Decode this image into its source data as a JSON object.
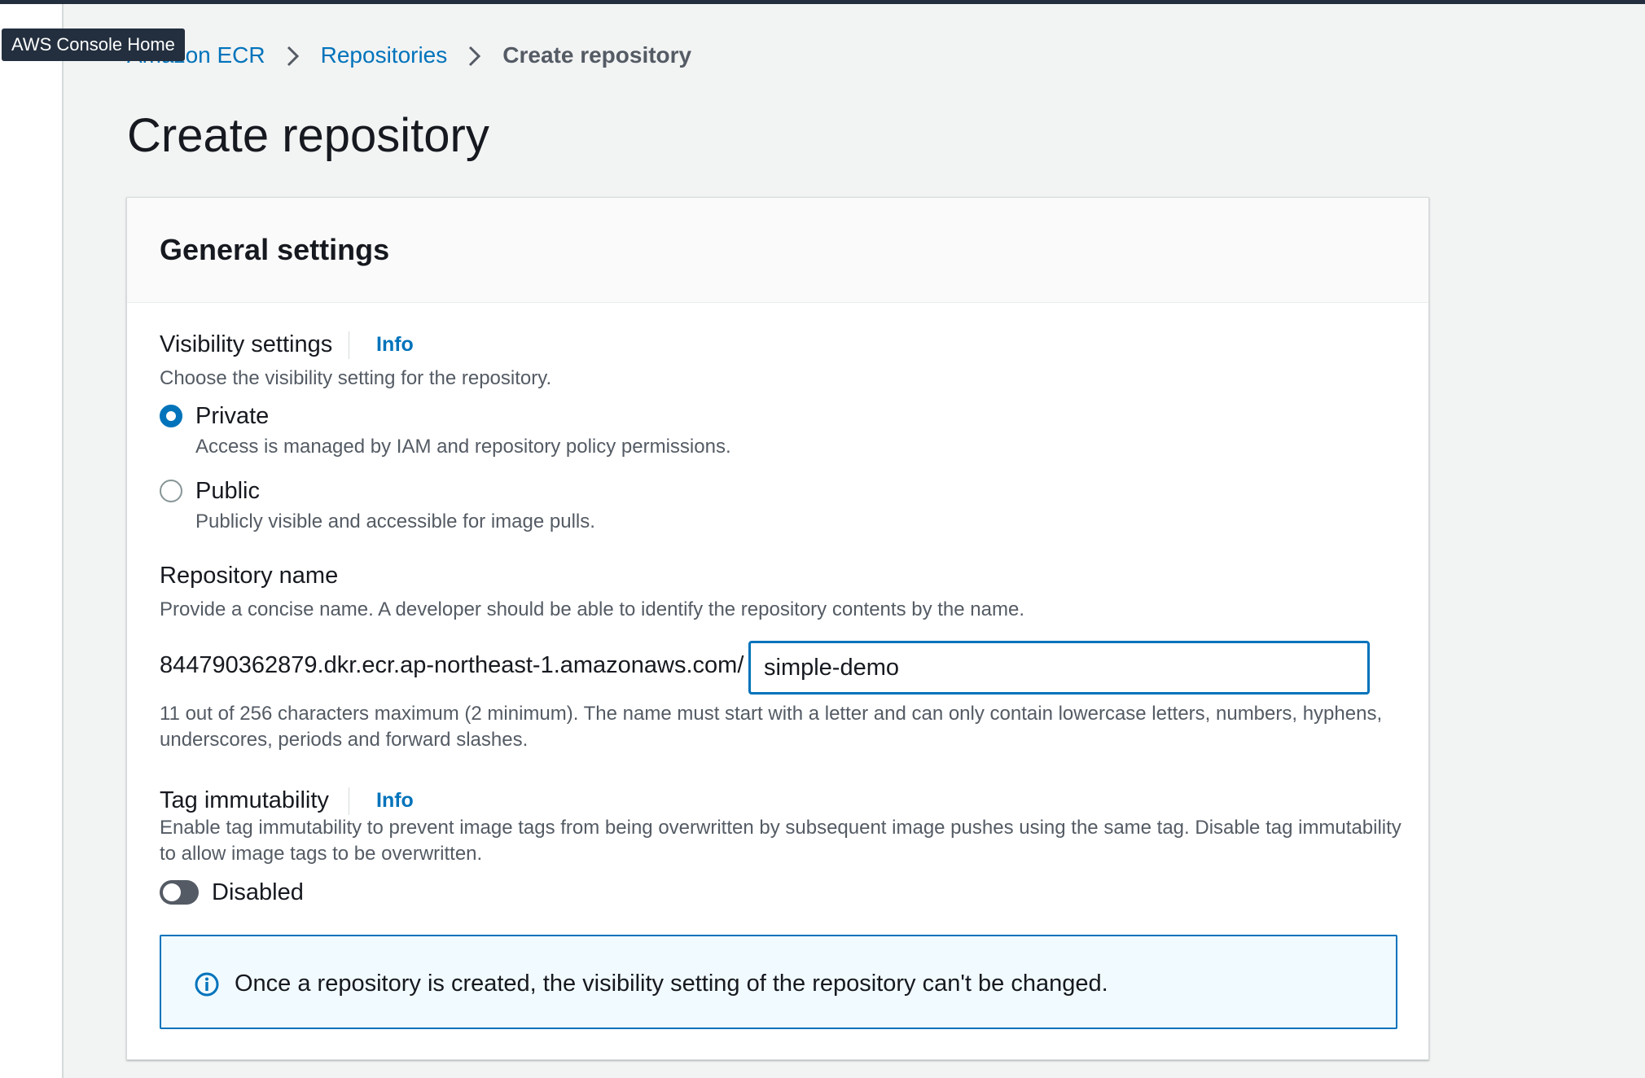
{
  "tooltip": "AWS Console Home",
  "breadcrumb": {
    "items": [
      "Amazon ECR",
      "Repositories"
    ],
    "current": "Create repository"
  },
  "page": {
    "title": "Create repository"
  },
  "general_settings": {
    "title": "General settings",
    "visibility": {
      "label": "Visibility settings",
      "info": "Info",
      "description": "Choose the visibility setting for the repository.",
      "options": [
        {
          "label": "Private",
          "description": "Access is managed by IAM and repository policy permissions.",
          "selected": true
        },
        {
          "label": "Public",
          "description": "Publicly visible and accessible for image pulls.",
          "selected": false
        }
      ]
    },
    "repository_name": {
      "label": "Repository name",
      "description": "Provide a concise name. A developer should be able to identify the repository contents by the name.",
      "prefix": "844790362879.dkr.ecr.ap-northeast-1.amazonaws.com/",
      "value": "simple-demo",
      "constraint": "11 out of 256 characters maximum (2 minimum). The name must start with a letter and can only contain lowercase letters, numbers, hyphens, underscores, periods and forward slashes."
    },
    "tag_immutability": {
      "label": "Tag immutability",
      "info": "Info",
      "description": "Enable tag immutability to prevent image tags from being overwritten by subsequent image pushes using the same tag. Disable tag immutability to allow image tags to be overwritten.",
      "state_label": "Disabled",
      "enabled": false
    },
    "alert": {
      "text": "Once a repository is created, the visibility setting of the repository can't be changed."
    }
  },
  "colors": {
    "link": "#0073bb",
    "text": "#16191f",
    "secondary_text": "#545b64",
    "background": "#f2f3f3",
    "alert_background": "#f1faff"
  },
  "icons": [
    "chevron-right-icon",
    "info-circle-icon"
  ]
}
